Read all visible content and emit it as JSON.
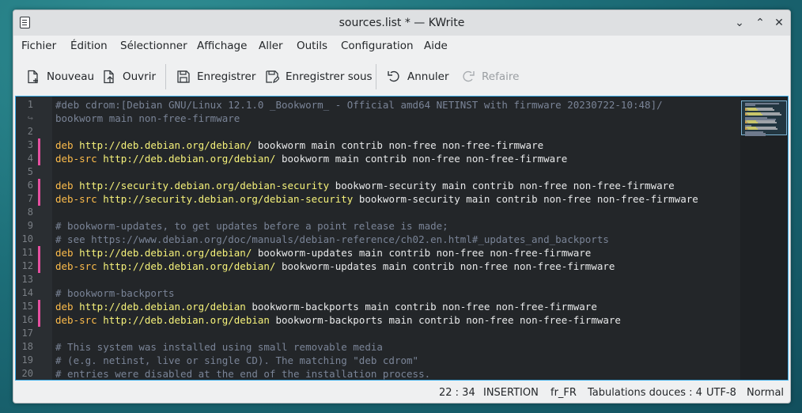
{
  "window": {
    "title": "sources.list * — KWrite"
  },
  "window_controls": {
    "minimize": "⌄",
    "maximize": "⌃",
    "close": "✕"
  },
  "menu": [
    "Fichier",
    "Édition",
    "Sélectionner",
    "Affichage",
    "Aller",
    "Outils",
    "Configuration",
    "Aide"
  ],
  "toolbar": {
    "nouveau": "Nouveau",
    "ouvrir": "Ouvrir",
    "enregistrer": "Enregistrer",
    "enregistrer_sous": "Enregistrer sous",
    "annuler": "Annuler",
    "refaire": "Refaire"
  },
  "editor": {
    "lines": [
      {
        "num": "1",
        "segs": [
          {
            "t": "#deb cdrom:[Debian GNU/Linux 12.1.0 _Bookworm_ - Official amd64 NETINST with firmware 20230722-10:48]/",
            "c": "comment"
          }
        ]
      },
      {
        "num": "↪",
        "segs": [
          {
            "t": "bookworm main non-free-firmware",
            "c": "comment"
          }
        ]
      },
      {
        "num": "2",
        "segs": []
      },
      {
        "num": "3",
        "segs": [
          {
            "t": "deb",
            "c": "kw"
          },
          {
            "t": " ",
            "c": "plain"
          },
          {
            "t": "http://deb.debian.org/debian/",
            "c": "url"
          },
          {
            "t": " bookworm main contrib non-free non-free-firmware",
            "c": "plain"
          }
        ]
      },
      {
        "num": "4",
        "segs": [
          {
            "t": "deb-src",
            "c": "kw"
          },
          {
            "t": " ",
            "c": "plain"
          },
          {
            "t": "http://deb.debian.org/debian/",
            "c": "url"
          },
          {
            "t": " bookworm main contrib non-free non-free-firmware",
            "c": "plain"
          }
        ]
      },
      {
        "num": "5",
        "segs": []
      },
      {
        "num": "6",
        "segs": [
          {
            "t": "deb",
            "c": "kw"
          },
          {
            "t": " ",
            "c": "plain"
          },
          {
            "t": "http://security.debian.org/debian-security",
            "c": "url"
          },
          {
            "t": " bookworm-security main contrib non-free non-free-firmware",
            "c": "plain"
          }
        ]
      },
      {
        "num": "7",
        "segs": [
          {
            "t": "deb-src",
            "c": "kw"
          },
          {
            "t": " ",
            "c": "plain"
          },
          {
            "t": "http://security.debian.org/debian-security",
            "c": "url"
          },
          {
            "t": " bookworm-security main contrib non-free non-free-firmware",
            "c": "plain"
          }
        ]
      },
      {
        "num": "8",
        "segs": []
      },
      {
        "num": "9",
        "segs": [
          {
            "t": "# bookworm-updates, to get updates before a point release is made;",
            "c": "comment"
          }
        ]
      },
      {
        "num": "10",
        "segs": [
          {
            "t": "# see https://www.debian.org/doc/manuals/debian-reference/ch02.en.html#_updates_and_backports",
            "c": "comment"
          }
        ]
      },
      {
        "num": "11",
        "segs": [
          {
            "t": "deb",
            "c": "kw"
          },
          {
            "t": " ",
            "c": "plain"
          },
          {
            "t": "http://deb.debian.org/debian/",
            "c": "url"
          },
          {
            "t": " bookworm-updates main contrib non-free non-free-firmware",
            "c": "plain"
          }
        ]
      },
      {
        "num": "12",
        "segs": [
          {
            "t": "deb-src",
            "c": "kw"
          },
          {
            "t": " ",
            "c": "plain"
          },
          {
            "t": "http://deb.debian.org/debian/",
            "c": "url"
          },
          {
            "t": " bookworm-updates main contrib non-free non-free-firmware",
            "c": "plain"
          }
        ]
      },
      {
        "num": "13",
        "segs": []
      },
      {
        "num": "14",
        "segs": [
          {
            "t": "# bookworm-backports",
            "c": "comment"
          }
        ]
      },
      {
        "num": "15",
        "segs": [
          {
            "t": "deb",
            "c": "kw"
          },
          {
            "t": " ",
            "c": "plain"
          },
          {
            "t": "http://deb.debian.org/debian",
            "c": "url"
          },
          {
            "t": " bookworm-backports main contrib non-free non-free-firmware",
            "c": "plain"
          }
        ]
      },
      {
        "num": "16",
        "segs": [
          {
            "t": "deb-src",
            "c": "kw"
          },
          {
            "t": " ",
            "c": "plain"
          },
          {
            "t": "http://deb.debian.org/debian",
            "c": "url"
          },
          {
            "t": " bookworm-backports main contrib non-free non-free-firmware",
            "c": "plain"
          }
        ]
      },
      {
        "num": "17",
        "segs": []
      },
      {
        "num": "18",
        "segs": [
          {
            "t": "# This system was installed using small removable media",
            "c": "comment"
          }
        ]
      },
      {
        "num": "19",
        "segs": [
          {
            "t": "# (e.g. netinst, live or single CD). The matching \"deb cdrom\"",
            "c": "comment"
          }
        ]
      },
      {
        "num": "20",
        "segs": [
          {
            "t": "# entries were disabled at the end of the installation process.",
            "c": "comment"
          }
        ]
      }
    ],
    "modified_lines": [
      "3",
      "4",
      "6",
      "7",
      "11",
      "12",
      "15",
      "16"
    ]
  },
  "status": {
    "position": "22 : 34",
    "mode": "INSERTION",
    "language": "fr_FR",
    "indent": "Tabulations douces : 4",
    "encoding": "UTF-8",
    "highlight": "Normal"
  },
  "colors": {
    "comment": "#7a8497",
    "keyword": "#fdbc4b",
    "url": "#f6f27a",
    "modified_marker": "#e64fa0",
    "focus": "#3daee9"
  }
}
